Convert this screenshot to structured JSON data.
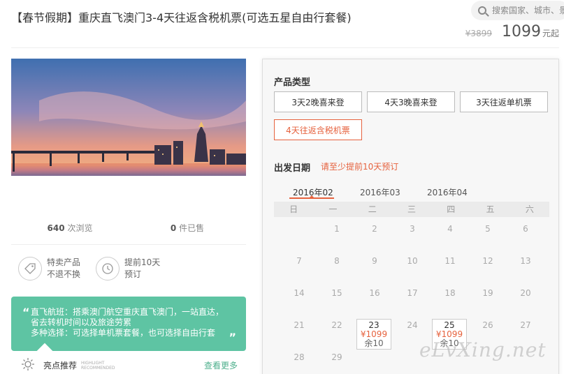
{
  "header": {
    "title": "【春节假期】重庆直飞澳门3-4天往返含税机票(可选五星自由行套餐)",
    "search_placeholder": "搜索国家、城市、景",
    "old_price": "¥3899",
    "price": "1099",
    "price_unit": "元起"
  },
  "stats": {
    "views_count": "640",
    "views_label": "次浏览",
    "sold_count": "0",
    "sold_label": "件已售"
  },
  "features": [
    {
      "icon": "tag-icon",
      "line1": "特卖产品",
      "line2": "不退不换"
    },
    {
      "icon": "clock-icon",
      "line1": "提前10天",
      "line2": "预订"
    }
  ],
  "intro": {
    "line1": "直飞航班：搭乘澳门航空重庆直飞澳门，一站直达，",
    "line2": "省去转机时间以及旅途劳累",
    "line3": "多种选择：可选择单机票套餐，也可选择自由行套"
  },
  "highlight": {
    "title": "亮点推荐",
    "en_line1": "HIGHLIGHT",
    "en_line2": "RECOMMENDED",
    "more": "查看更多"
  },
  "booking": {
    "type_label": "产品类型",
    "types": [
      "3天2晚喜来登",
      "4天3晚喜来登",
      "3天往返单机票",
      "4天往返含税机票"
    ],
    "active_type_index": 3,
    "date_label": "出发日期",
    "date_note": "请至少提前10天预订",
    "months": [
      "2016年02",
      "2016年03",
      "2016年04"
    ],
    "weekdays": [
      "日",
      "一",
      "二",
      "三",
      "四",
      "五",
      "六"
    ],
    "days": {
      "row1": [
        "1",
        "2",
        "3",
        "4",
        "5",
        "6"
      ],
      "row2": [
        "7",
        "8",
        "9",
        "10",
        "11",
        "12",
        "13"
      ],
      "row3": [
        "14",
        "15",
        "16",
        "17",
        "18",
        "19",
        "20"
      ],
      "row4": [
        "21",
        "22",
        "24",
        "26",
        "27"
      ],
      "row5": [
        "28",
        "29"
      ]
    },
    "available": [
      {
        "day": "23",
        "price": "¥1099",
        "remain": "余10"
      },
      {
        "day": "25",
        "price": "¥1099",
        "remain": "余10"
      }
    ]
  },
  "watermark": "eLvXing.net"
}
